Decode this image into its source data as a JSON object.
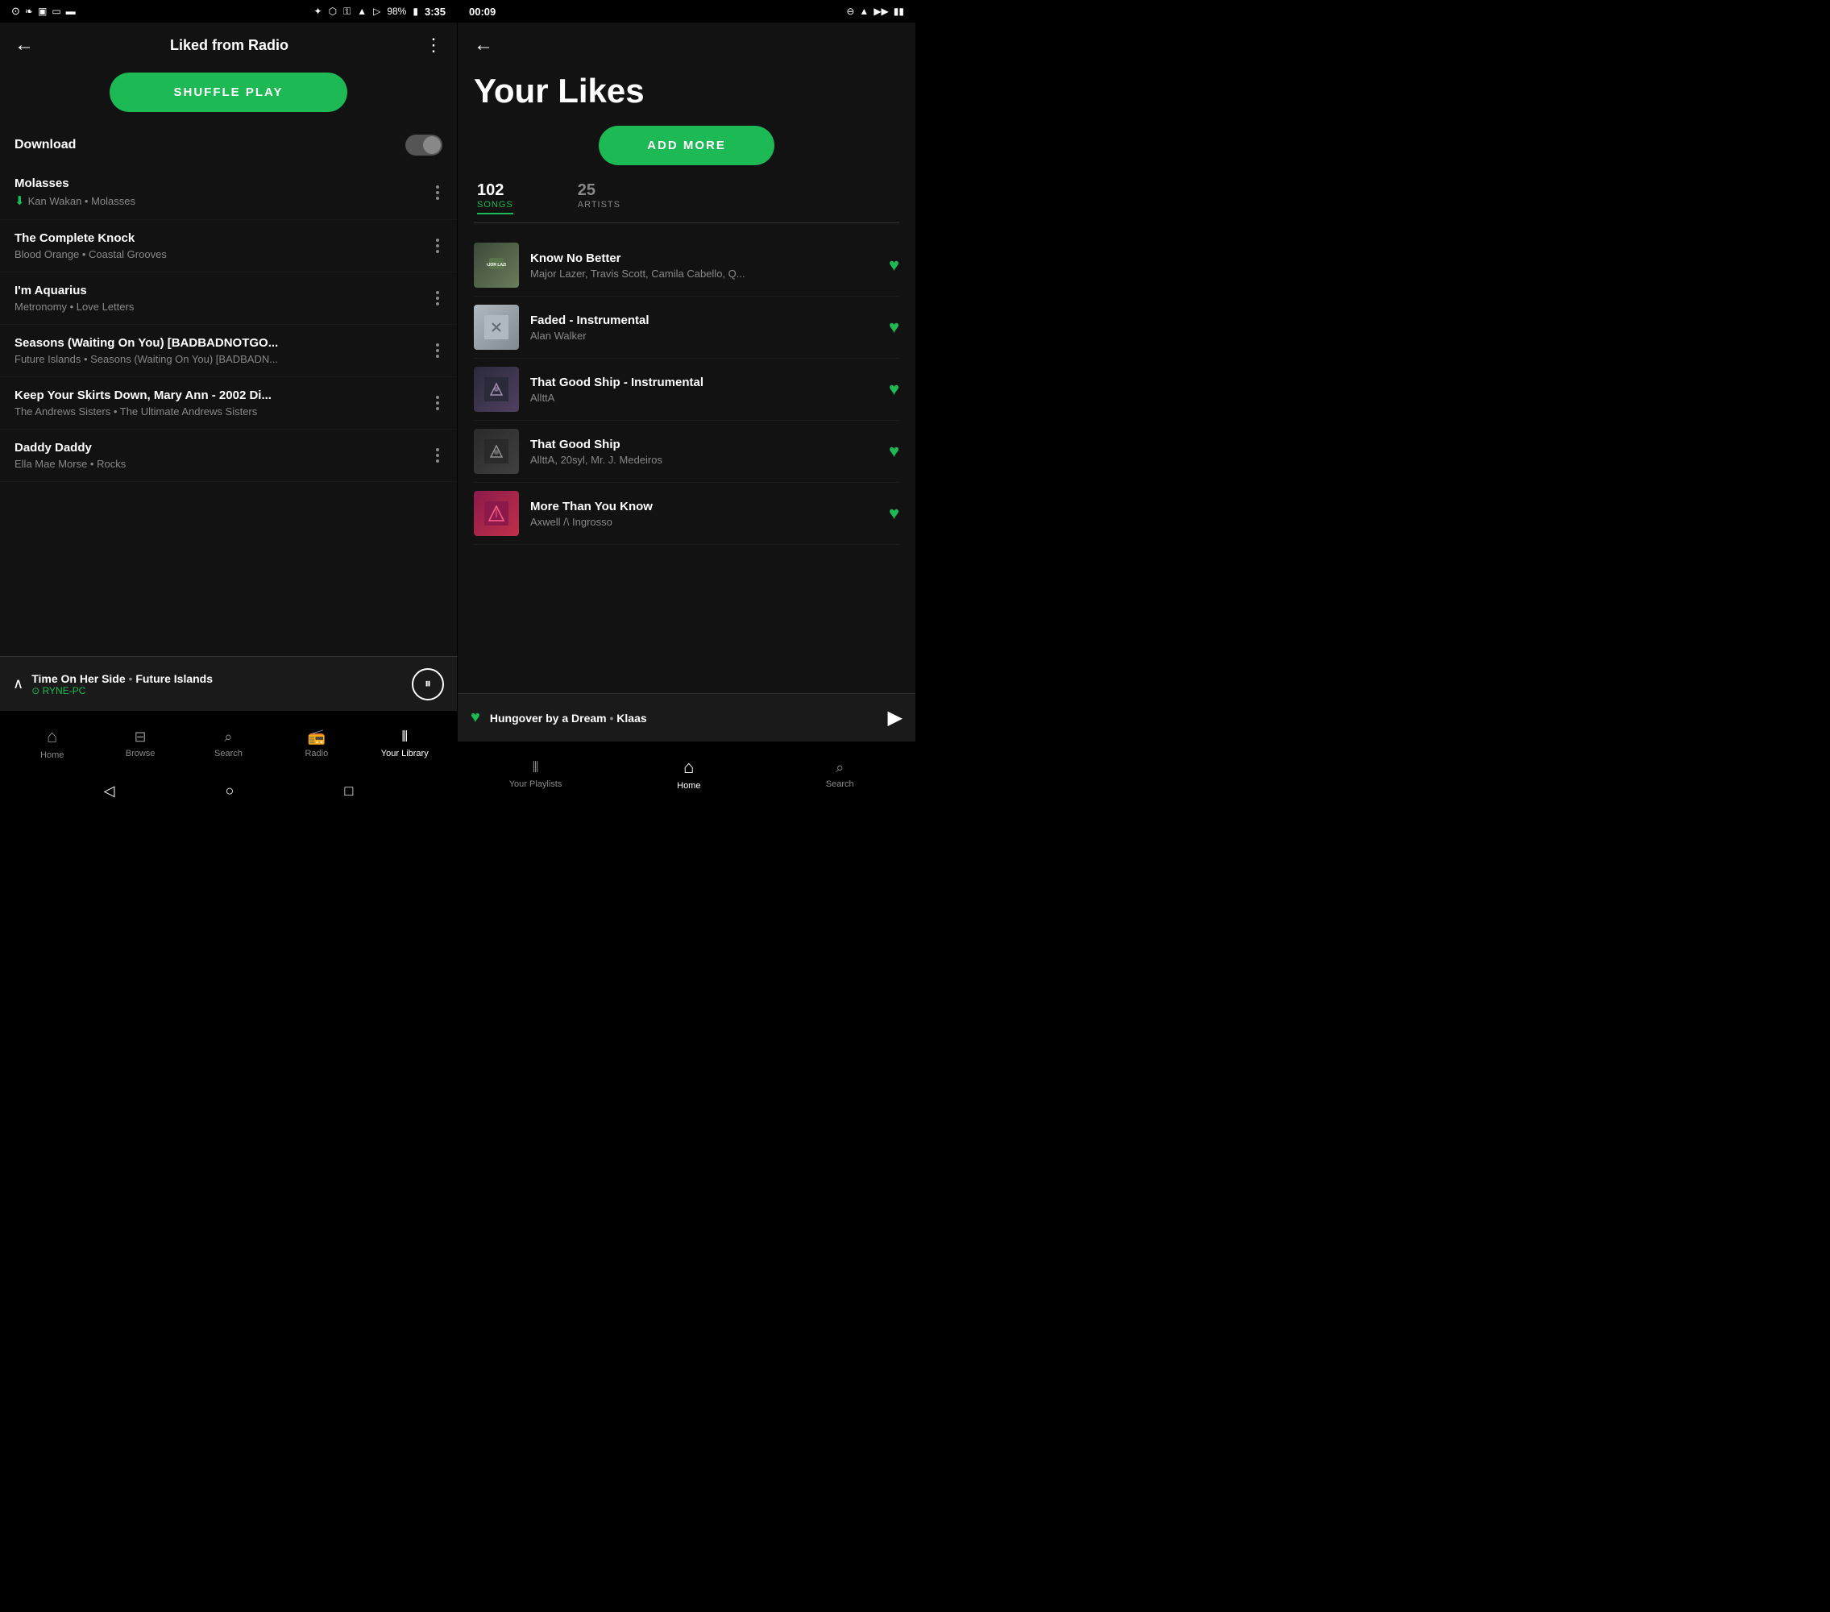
{
  "left": {
    "statusBar": {
      "time": "3:35",
      "battery": "98%"
    },
    "header": {
      "title": "Liked from Radio",
      "backIcon": "←",
      "moreIcon": "⋮"
    },
    "shuffleBtn": "SHUFFLE PLAY",
    "download": {
      "label": "Download"
    },
    "songs": [
      {
        "title": "Molasses",
        "artist": "Kan Wakan",
        "album": "Molasses",
        "downloaded": true
      },
      {
        "title": "The Complete Knock",
        "artist": "Blood Orange",
        "album": "Coastal Grooves",
        "downloaded": false
      },
      {
        "title": "I'm Aquarius",
        "artist": "Metronomy",
        "album": "Love Letters",
        "downloaded": false
      },
      {
        "title": "Seasons (Waiting On You) [BADBADNOTGO...",
        "artist": "Future Islands",
        "album": "Seasons (Waiting On You) [BADBADN...",
        "downloaded": false
      },
      {
        "title": "Keep Your Skirts Down, Mary Ann - 2002 Di...",
        "artist": "The Andrews Sisters",
        "album": "The Ultimate Andrews Sisters",
        "downloaded": false
      },
      {
        "title": "Daddy Daddy",
        "artist": "Ella Mae Morse",
        "album": "Rocks",
        "downloaded": false
      }
    ],
    "nowPlaying": {
      "chevron": "∧",
      "title": "Time On Her Side",
      "artist": "Future Islands",
      "device": "RYNE-PC",
      "pauseIcon": "⏸"
    },
    "bottomNav": [
      {
        "icon": "⌂",
        "label": "Home",
        "active": false
      },
      {
        "icon": "⊟",
        "label": "Browse",
        "active": false
      },
      {
        "icon": "🔍",
        "label": "Search",
        "active": false
      },
      {
        "icon": "📻",
        "label": "Radio",
        "active": false
      },
      {
        "icon": "|||",
        "label": "Your Library",
        "active": true
      }
    ]
  },
  "right": {
    "statusBar": {
      "time": "00:09"
    },
    "backIcon": "←",
    "pageTitle": "Your Likes",
    "addMoreBtn": "ADD MORE",
    "stats": {
      "songs": {
        "count": "102",
        "label": "SONGS"
      },
      "artists": {
        "count": "25",
        "label": "ARTISTS"
      }
    },
    "songs": [
      {
        "title": "Know No Better",
        "artist": "Major Lazer, Travis Scott, Camila Cabello, Q...",
        "artClass": "art-1",
        "liked": true
      },
      {
        "title": "Faded - Instrumental",
        "artist": "Alan Walker",
        "artClass": "art-2",
        "liked": true
      },
      {
        "title": "That Good Ship - Instrumental",
        "artist": "AllttA",
        "artClass": "art-3",
        "liked": true
      },
      {
        "title": "That Good Ship",
        "artist": "AllttA, 20syl, Mr. J. Medeiros",
        "artClass": "art-4",
        "liked": true
      },
      {
        "title": "More Than You Know",
        "artist": "Axwell /\\ Ingrosso",
        "artClass": "art-5",
        "liked": true
      }
    ],
    "miniPlayer": {
      "title": "Hungover by a Dream",
      "artist": "Klaas",
      "playIcon": "▶"
    },
    "bottomNav": [
      {
        "icon": "|||",
        "label": "Your Playlists",
        "active": false
      },
      {
        "icon": "⌂",
        "label": "Home",
        "active": true
      },
      {
        "icon": "🔍",
        "label": "Search",
        "active": false
      }
    ]
  }
}
